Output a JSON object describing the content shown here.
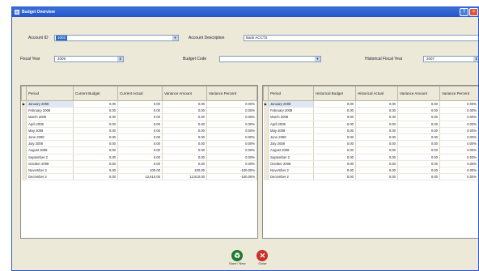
{
  "window": {
    "title": "Budget Overview"
  },
  "titlebar": {
    "buttons": [
      "?",
      "×"
    ]
  },
  "filters": {
    "account_id_label": "Account ID",
    "account_id_value": "1002",
    "account_desc_label": "Account Description",
    "account_desc_value": "Bank ACCTS",
    "fiscal_year_label": "Fiscal Year",
    "fiscal_year_value": "2009",
    "budget_code_label": "Budget Code",
    "budget_code_value": "",
    "hist_year_label": "Historical Fiscal Year",
    "hist_year_value": "2007"
  },
  "current_grid": {
    "headers": [
      "Period",
      "Current Budget",
      "Current Actual",
      "Variance Amount",
      "Variance Percent"
    ],
    "rows": [
      [
        "January 2008",
        "0.00",
        "0.00",
        "0.00",
        "0.00%"
      ],
      [
        "February 2008",
        "0.00",
        "0.00",
        "0.00",
        "0.00%"
      ],
      [
        "March 2008",
        "0.00",
        "0.00",
        "0.00",
        "0.00%"
      ],
      [
        "April 2008",
        "0.00",
        "0.00",
        "0.00",
        "0.00%"
      ],
      [
        "May 2008",
        "0.00",
        "0.00",
        "0.00",
        "0.00%"
      ],
      [
        "June 2008",
        "0.00",
        "0.00",
        "0.00",
        "0.00%"
      ],
      [
        "July 2008",
        "0.00",
        "0.00",
        "0.00",
        "0.00%"
      ],
      [
        "August 2008",
        "0.00",
        "0.00",
        "0.00",
        "0.00%"
      ],
      [
        "September 2",
        "0.00",
        "0.00",
        "0.00",
        "0.00%"
      ],
      [
        "October 2008",
        "0.00",
        "0.00",
        "0.00",
        "0.00%"
      ],
      [
        "November 2",
        "0.00",
        "100.00",
        "100.00",
        "-100.00%"
      ],
      [
        "December 2",
        "0.00",
        "12,610.00",
        "12,610.00",
        "-100.00%"
      ]
    ]
  },
  "historical_grid": {
    "headers": [
      "Period",
      "Historical Budget",
      "Historical Actual",
      "Variance Amount",
      "Variance Percent"
    ],
    "rows": [
      [
        "January 2008",
        "0.00",
        "0.00",
        "0.00",
        "0.00%"
      ],
      [
        "February 2008",
        "0.00",
        "0.00",
        "0.00",
        "0.00%"
      ],
      [
        "March 2008",
        "0.00",
        "0.00",
        "0.00",
        "0.00%"
      ],
      [
        "April 2008",
        "0.00",
        "0.00",
        "0.00",
        "0.00%"
      ],
      [
        "May 2008",
        "0.00",
        "0.00",
        "0.00",
        "0.00%"
      ],
      [
        "June 2008",
        "0.00",
        "0.00",
        "0.00",
        "0.00%"
      ],
      [
        "July 2008",
        "0.00",
        "0.00",
        "0.00",
        "0.00%"
      ],
      [
        "August 2008",
        "0.00",
        "0.00",
        "0.00",
        "0.00%"
      ],
      [
        "September 2",
        "0.00",
        "0.00",
        "0.00",
        "0.00%"
      ],
      [
        "October 2008",
        "0.00",
        "0.00",
        "0.00",
        "0.00%"
      ],
      [
        "November 2",
        "0.00",
        "0.00",
        "0.00",
        "0.00%"
      ],
      [
        "December 2",
        "0.00",
        "0.00",
        "0.00",
        "0.00%"
      ]
    ]
  },
  "actions": {
    "save_label": "Save / New",
    "close_label": "Close"
  },
  "icons": {
    "save": "recycle-icon",
    "close": "close-icon"
  },
  "colors": {
    "titlebar": "#2356c9",
    "selection": "#316ac5",
    "dialog_bg": "#ece9d8",
    "save_icon": "#1f7a2e",
    "close_icon": "#c8312a"
  }
}
